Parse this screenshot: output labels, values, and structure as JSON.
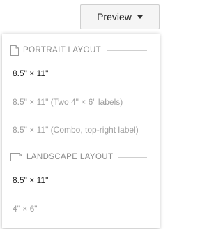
{
  "preview_button": {
    "label": "Preview",
    "icon": "caret-down-icon"
  },
  "menu": {
    "sections": [
      {
        "title": "PORTRAIT LAYOUT",
        "icon": "portrait-page-icon",
        "items": [
          {
            "label": "8.5\" × 11\"",
            "enabled": true
          },
          {
            "label": "8.5\" × 11\" (Two 4\" × 6\" labels)",
            "enabled": false
          },
          {
            "label": "8.5\" × 11\" (Combo, top-right label)",
            "enabled": false
          }
        ]
      },
      {
        "title": "LANDSCAPE LAYOUT",
        "icon": "landscape-page-icon",
        "items": [
          {
            "label": "8.5\" × 11\"",
            "enabled": true
          },
          {
            "label": "4\" × 6\"",
            "enabled": false
          }
        ]
      }
    ]
  },
  "colors": {
    "enabled_text": "#222222",
    "disabled_text": "#9e9e9e",
    "header_text": "#8c8c8c",
    "button_bg": "#f5f5f5"
  }
}
